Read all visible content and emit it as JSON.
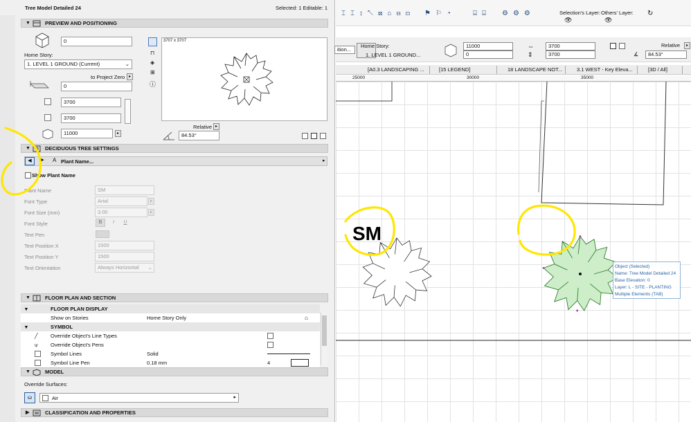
{
  "panel": {
    "title": "Tree Model Detailed 24",
    "selection_info": "Selected: 1 Editable: 1",
    "preview": {
      "header": "PREVIEW AND POSITIONING",
      "elevation_value": "0",
      "home_story_label": "Home Story:",
      "home_story_value": "1. LEVEL 1 GROUND (Current)",
      "to_project_zero": "to Project Zero",
      "zero_value": "0",
      "width_value": "3700",
      "depth_value": "3700",
      "height_value": "11000",
      "preview_size": "3707 x 3707",
      "relative_label": "Relative",
      "angle_value": "84.53°"
    },
    "tree_settings": {
      "header": "DECIDUOUS TREE SETTINGS",
      "plant_name_tab": "Plant Name...",
      "show_plant_name": "Show Plant Name",
      "fields": [
        {
          "label": "Plant Name",
          "value": "SM"
        },
        {
          "label": "Font Type",
          "value": "Arial"
        },
        {
          "label": "Font Size (mm)",
          "value": "3.00"
        },
        {
          "label": "Font Style",
          "value": ""
        },
        {
          "label": "Text Pen",
          "value": ""
        },
        {
          "label": "Text Position X",
          "value": "1500"
        },
        {
          "label": "Text Position Y",
          "value": "1500"
        },
        {
          "label": "Text Orientation",
          "value": "Always Horizontal"
        }
      ],
      "font_style_buttons": [
        "B",
        "I",
        "U"
      ]
    },
    "floor_plan": {
      "header": "FLOOR PLAN AND SECTION",
      "display_header": "FLOOR PLAN DISPLAY",
      "show_on_stories_label": "Show on Stories",
      "show_on_stories_value": "Home Story Only",
      "symbol_header": "SYMBOL",
      "override_line_types": "Override Object's Line Types",
      "override_pens": "Override Object's Pens",
      "symbol_lines_label": "Symbol Lines",
      "symbol_lines_value": "Solid",
      "symbol_line_pen_label": "Symbol Line Pen",
      "symbol_line_pen_value": "0.18 mm",
      "symbol_line_pen_number": "4"
    },
    "model": {
      "header": "MODEL",
      "override_surfaces": "Override Surfaces:",
      "surface_value": "Air"
    },
    "classification_header": "CLASSIFICATION AND PROPERTIES"
  },
  "canvas": {
    "selections_layer": "Selection's Layer:",
    "others_layer": "Others' Layer:",
    "home_story_label": "Home Story:",
    "home_story_value": "1. LEVEL 1 GROUND...",
    "elevation_top": "11000",
    "elevation_bottom": "0",
    "dim_top": "3700",
    "dim_bottom": "3700",
    "relative_label": "Relative",
    "angle_value": "84.53°",
    "dropdown_fragment": "ition...",
    "view_tabs": [
      "[A0.3 LANDSCAPING ...",
      "[15 LEGEND]",
      "18 LANDSCAPE NOT...",
      "3.1 WEST - Key Eleva...",
      "[3D / All]"
    ],
    "ruler_ticks": [
      "25000",
      "30000",
      "35000"
    ],
    "plant_label": "SM",
    "tooltip": {
      "title": "Object (Selected)",
      "name": "Name: Tree Model Detailed 24",
      "base": "Base Elevation: 0",
      "layer": "Layer: L - SITE - PLANTING",
      "multi": "Multiple Elements (TAB)"
    }
  },
  "colors": {
    "highlight": "#ffe600",
    "selected_fill": "#cdeec8",
    "selected_stroke": "#2c7a2c",
    "accent": "#2864a8"
  }
}
